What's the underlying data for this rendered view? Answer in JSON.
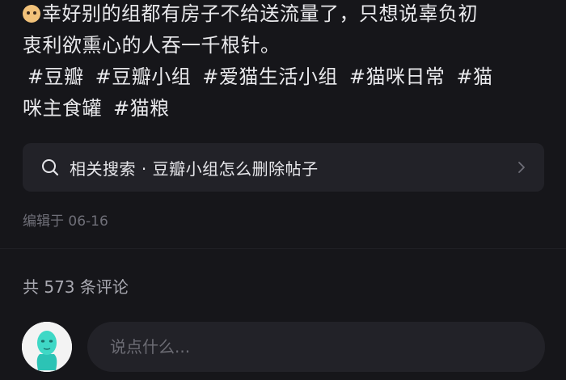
{
  "post": {
    "line1": "幸好别的组都有房子不给送流量了，只想说辜负初",
    "line2": "衷利欲熏心的人吞一千根针。",
    "tags": [
      "#豆瓣",
      "#豆瓣小组",
      "#爱猫生活小组",
      "#猫咪日常",
      "#猫",
      "咪主食罐",
      "#猫粮"
    ]
  },
  "related_search": {
    "text": "相关搜索 · 豆瓣小组怎么删除帖子",
    "icon": "search-icon"
  },
  "edited": "编辑于 06-16",
  "comments": {
    "count_text": "共 573 条评论",
    "input_placeholder": "说点什么..."
  },
  "colors": {
    "background": "#16161a",
    "card": "#222228",
    "text": "#e9e9ec",
    "muted": "#6f6f78"
  }
}
